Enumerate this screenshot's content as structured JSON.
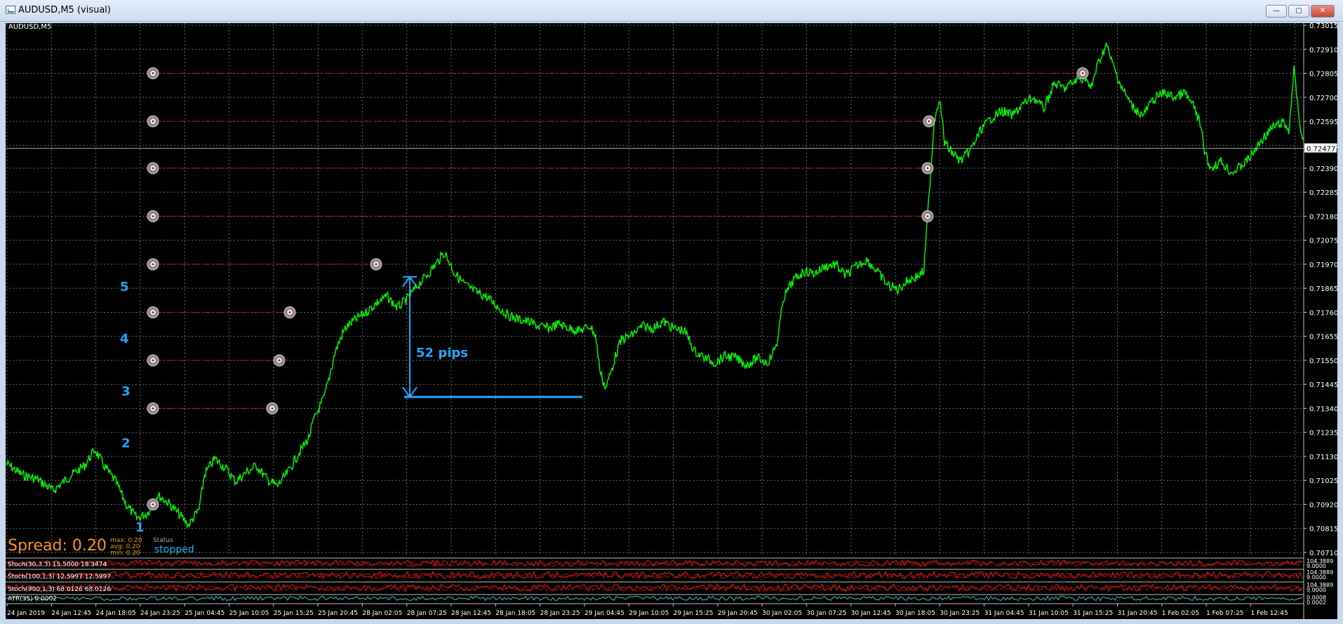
{
  "window": {
    "title": "AUDUSD,M5 (visual)",
    "min_glyph": "—",
    "max_glyph": "▢",
    "close_glyph": "✕"
  },
  "chart": {
    "symbol_label": "AUDUSD,M5",
    "current_price": "0.72477",
    "spread_label": "Spread: 0.20",
    "spread_stats": [
      "max: 0.20",
      "avg: 0.20",
      "min: 0.20"
    ],
    "status_caption": "Status",
    "status_value": "stopped",
    "pips_label": "52 pips",
    "level_numbers": [
      "1",
      "2",
      "3",
      "4",
      "5"
    ]
  },
  "chart_data": {
    "type": "line",
    "color": "#00ff00",
    "series": [],
    "y_ticks": [
      "0.73015",
      "0.72910",
      "0.72805",
      "0.72700",
      "0.72595",
      "0.72490",
      "0.72390",
      "0.72285",
      "0.72180",
      "0.72075",
      "0.71970",
      "0.71865",
      "0.71760",
      "0.71655",
      "0.71550",
      "0.71445",
      "0.71340",
      "0.71235",
      "0.71130",
      "0.71025",
      "0.70920",
      "0.70815",
      "0.70710"
    ],
    "x_ticks": [
      "24 Jan 2019",
      "24 Jan 12:45",
      "24 Jan 18:05",
      "24 Jan 23:25",
      "25 Jan 04:45",
      "25 Jan 10:05",
      "25 Jan 15:25",
      "25 Jan 20:45",
      "28 Jan 02:05",
      "28 Jan 07:25",
      "28 Jan 12:45",
      "28 Jan 18:05",
      "28 Jan 23:25",
      "29 Jan 04:45",
      "29 Jan 10:05",
      "29 Jan 15:25",
      "29 Jan 20:45",
      "30 Jan 02:05",
      "30 Jan 07:25",
      "30 Jan 12:45",
      "30 Jan 18:05",
      "30 Jan 23:25",
      "31 Jan 04:45",
      "31 Jan 10:05",
      "31 Jan 15:25",
      "31 Jan 20:45",
      "1 Feb 02:05",
      "1 Feb 07:25",
      "1 Feb 12:45"
    ],
    "grid": true,
    "ylim": [
      0.7071,
      0.73015
    ],
    "horizontal_levels": [
      0.7139,
      0.71495,
      0.716,
      0.71705,
      0.7181,
      0.71915,
      0.72125,
      0.7223,
      0.72335,
      0.72545
    ],
    "price_path": [
      [
        0,
        0.711
      ],
      [
        3,
        0.7105
      ],
      [
        6,
        0.7103
      ],
      [
        9,
        0.7098
      ],
      [
        12,
        0.7104
      ],
      [
        15,
        0.7109
      ],
      [
        17,
        0.7116
      ],
      [
        19,
        0.7108
      ],
      [
        21,
        0.7102
      ],
      [
        23,
        0.7092
      ],
      [
        25,
        0.7086
      ],
      [
        27,
        0.7088
      ],
      [
        29,
        0.7096
      ],
      [
        31,
        0.7093
      ],
      [
        33,
        0.7088
      ],
      [
        35,
        0.7083
      ],
      [
        37,
        0.709
      ],
      [
        38,
        0.7105
      ],
      [
        40,
        0.7112
      ],
      [
        42,
        0.7108
      ],
      [
        44,
        0.7102
      ],
      [
        46,
        0.7106
      ],
      [
        48,
        0.7109
      ],
      [
        50,
        0.7103
      ],
      [
        52,
        0.71
      ],
      [
        54,
        0.7106
      ],
      [
        56,
        0.7114
      ],
      [
        58,
        0.7121
      ],
      [
        59,
        0.7129
      ],
      [
        61,
        0.7139
      ],
      [
        62,
        0.7148
      ],
      [
        63,
        0.7158
      ],
      [
        64,
        0.7164
      ],
      [
        65,
        0.7169
      ],
      [
        67,
        0.7173
      ],
      [
        69,
        0.7176
      ],
      [
        71,
        0.718
      ],
      [
        73,
        0.7183
      ],
      [
        75,
        0.7178
      ],
      [
        77,
        0.7182
      ],
      [
        79,
        0.7188
      ],
      [
        81,
        0.7193
      ],
      [
        82,
        0.7196
      ],
      [
        83,
        0.7199
      ],
      [
        84,
        0.7202
      ],
      [
        85,
        0.7198
      ],
      [
        86,
        0.7193
      ],
      [
        88,
        0.7188
      ],
      [
        90,
        0.7185
      ],
      [
        92,
        0.7183
      ],
      [
        94,
        0.7179
      ],
      [
        96,
        0.7175
      ],
      [
        98,
        0.7173
      ],
      [
        100,
        0.7172
      ],
      [
        102,
        0.717
      ],
      [
        104,
        0.7169
      ],
      [
        106,
        0.7171
      ],
      [
        108,
        0.7169
      ],
      [
        110,
        0.7168
      ],
      [
        112,
        0.717
      ],
      [
        113,
        0.7166
      ],
      [
        114,
        0.7149
      ],
      [
        115,
        0.7143
      ],
      [
        116,
        0.715
      ],
      [
        117,
        0.7158
      ],
      [
        118,
        0.7164
      ],
      [
        120,
        0.7166
      ],
      [
        122,
        0.717
      ],
      [
        124,
        0.7169
      ],
      [
        126,
        0.7172
      ],
      [
        128,
        0.7169
      ],
      [
        130,
        0.7168
      ],
      [
        131,
        0.7164
      ],
      [
        132,
        0.7159
      ],
      [
        134,
        0.7156
      ],
      [
        136,
        0.7154
      ],
      [
        138,
        0.7157
      ],
      [
        140,
        0.7156
      ],
      [
        142,
        0.7153
      ],
      [
        144,
        0.7156
      ],
      [
        146,
        0.7154
      ],
      [
        147,
        0.7158
      ],
      [
        148,
        0.7164
      ],
      [
        149,
        0.7182
      ],
      [
        150,
        0.7186
      ],
      [
        151,
        0.719
      ],
      [
        153,
        0.7194
      ],
      [
        155,
        0.7193
      ],
      [
        157,
        0.7196
      ],
      [
        159,
        0.7197
      ],
      [
        161,
        0.7192
      ],
      [
        163,
        0.7196
      ],
      [
        165,
        0.7199
      ],
      [
        167,
        0.7194
      ],
      [
        169,
        0.7188
      ],
      [
        171,
        0.7186
      ],
      [
        173,
        0.719
      ],
      [
        175,
        0.7192
      ],
      [
        176,
        0.7194
      ],
      [
        177,
        0.7227
      ],
      [
        178,
        0.726
      ],
      [
        179,
        0.727
      ],
      [
        180,
        0.725
      ],
      [
        181,
        0.7247
      ],
      [
        183,
        0.7242
      ],
      [
        185,
        0.7247
      ],
      [
        187,
        0.7256
      ],
      [
        189,
        0.7261
      ],
      [
        191,
        0.7264
      ],
      [
        193,
        0.7262
      ],
      [
        195,
        0.7267
      ],
      [
        197,
        0.727
      ],
      [
        199,
        0.7265
      ],
      [
        201,
        0.7276
      ],
      [
        203,
        0.7274
      ],
      [
        205,
        0.7277
      ],
      [
        207,
        0.7279
      ],
      [
        208,
        0.7273
      ],
      [
        209,
        0.7282
      ],
      [
        210,
        0.7288
      ],
      [
        211,
        0.7293
      ],
      [
        212,
        0.7286
      ],
      [
        214,
        0.7274
      ],
      [
        216,
        0.7266
      ],
      [
        218,
        0.7262
      ],
      [
        220,
        0.7269
      ],
      [
        222,
        0.7272
      ],
      [
        224,
        0.727
      ],
      [
        226,
        0.7272
      ],
      [
        228,
        0.7265
      ],
      [
        229,
        0.7258
      ],
      [
        230,
        0.7245
      ],
      [
        231,
        0.7239
      ],
      [
        233,
        0.7242
      ],
      [
        235,
        0.7237
      ],
      [
        237,
        0.724
      ],
      [
        239,
        0.7245
      ],
      [
        241,
        0.7252
      ],
      [
        243,
        0.7257
      ],
      [
        245,
        0.7259
      ],
      [
        246,
        0.7255
      ],
      [
        247,
        0.7282
      ],
      [
        248,
        0.726
      ],
      [
        249,
        0.7248
      ]
    ]
  }
}
